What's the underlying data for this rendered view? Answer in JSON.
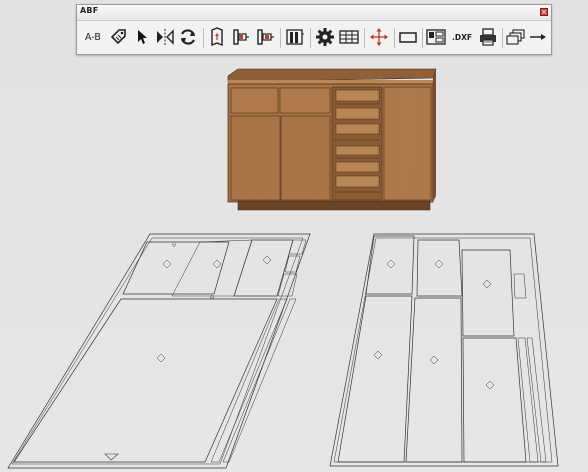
{
  "toolbar": {
    "title": "ABF",
    "close_glyph": "×",
    "buttons": [
      {
        "id": "a-b",
        "label": "A-B"
      },
      {
        "id": "tag-tool",
        "icon": "tag-icon"
      },
      {
        "id": "select-tool",
        "icon": "cursor-icon"
      },
      {
        "id": "flip-tool",
        "icon": "flip-icon"
      },
      {
        "id": "refresh-tool",
        "icon": "refresh-icon"
      },
      {
        "id": "edge-tool-1",
        "icon": "edge-banding-icon"
      },
      {
        "id": "edge-tool-2",
        "icon": "hardware-icon"
      },
      {
        "id": "edge-tool-3",
        "icon": "hardware-icon"
      },
      {
        "id": "panels-tool",
        "icon": "panels-icon"
      },
      {
        "id": "settings-tool",
        "icon": "gear-icon"
      },
      {
        "id": "table-tool",
        "icon": "table-icon"
      },
      {
        "id": "move-tool",
        "icon": "move-icon"
      },
      {
        "id": "rect-tool",
        "icon": "rectangle-icon"
      },
      {
        "id": "layout-tool",
        "icon": "layout-icon"
      },
      {
        "id": "dxf-export",
        "label": ".DXF"
      },
      {
        "id": "print-tool",
        "icon": "printer-icon"
      },
      {
        "id": "stack-tool",
        "icon": "stack-icon"
      },
      {
        "id": "line-tool",
        "icon": "arrow-line-icon"
      }
    ]
  },
  "colors": {
    "background": "#e6e6e6",
    "wood": "#a97548",
    "wood_dark": "#7a4e2c",
    "panel_line": "#444444",
    "close": "#d24545"
  }
}
